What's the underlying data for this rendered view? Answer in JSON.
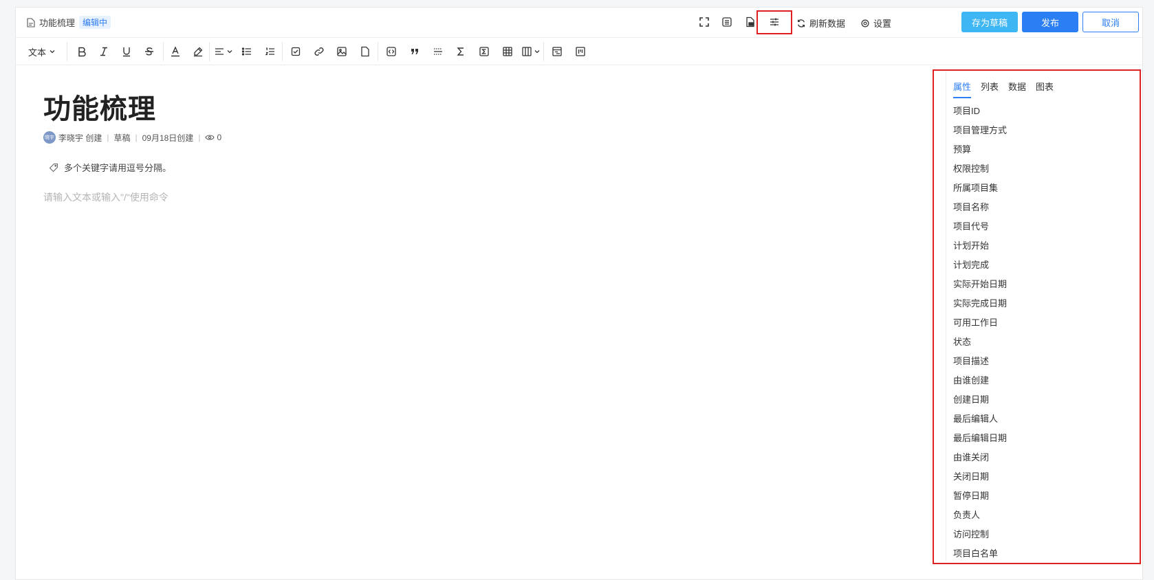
{
  "header": {
    "doc_title": "功能梳理",
    "status_badge": "编辑中",
    "refresh_label": "刷新数据",
    "settings_label": "设置",
    "save_draft_label": "存为草稿",
    "publish_label": "发布",
    "cancel_label": "取消"
  },
  "toolbar": {
    "text_style_label": "文本"
  },
  "editor": {
    "title": "功能梳理",
    "author_avatar": "晓宇",
    "author": "李晓宇 创建",
    "status": "草稿",
    "created": "09月18日创建",
    "views": "0",
    "tags_placeholder": "多个关键字请用逗号分隔。",
    "body_placeholder": "请输入文本或输入\"/\"使用命令"
  },
  "panel": {
    "tabs": [
      "属性",
      "列表",
      "数据",
      "图表"
    ],
    "active_tab": "属性",
    "properties": [
      "项目ID",
      "项目管理方式",
      "预算",
      "权限控制",
      "所属项目集",
      "项目名称",
      "项目代号",
      "计划开始",
      "计划完成",
      "实际开始日期",
      "实际完成日期",
      "可用工作日",
      "状态",
      "项目描述",
      "由谁创建",
      "创建日期",
      "最后编辑人",
      "最后编辑日期",
      "由谁关闭",
      "关闭日期",
      "暂停日期",
      "负责人",
      "访问控制",
      "项目白名单"
    ]
  },
  "colors": {
    "primary": "#2b7ef3",
    "draft": "#3fb6f4",
    "highlight": "#e02020"
  }
}
